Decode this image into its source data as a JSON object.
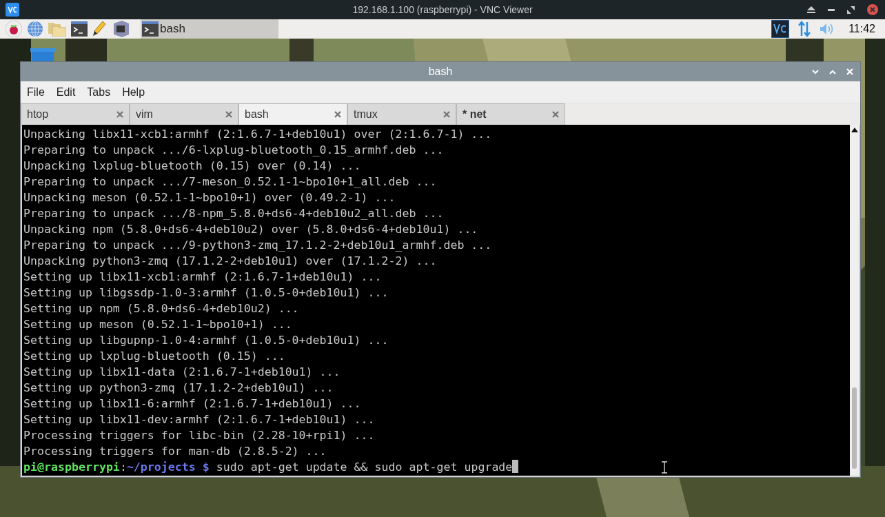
{
  "viewer": {
    "title": "192.168.1.100 (raspberrypi) - VNC Viewer"
  },
  "taskbar": {
    "task_buttons": [
      {
        "label": "bash",
        "selected": true
      }
    ],
    "clock": "11:42"
  },
  "terminal_window": {
    "title": "bash",
    "menu": [
      "File",
      "Edit",
      "Tabs",
      "Help"
    ],
    "tabs": [
      {
        "label": "htop",
        "selected": false,
        "bold": false
      },
      {
        "label": "vim",
        "selected": false,
        "bold": false
      },
      {
        "label": "bash",
        "selected": true,
        "bold": false
      },
      {
        "label": "tmux",
        "selected": false,
        "bold": false
      },
      {
        "label": "* net",
        "selected": false,
        "bold": true
      }
    ],
    "lines": [
      "Unpacking libx11-xcb1:armhf (2:1.6.7-1+deb10u1) over (2:1.6.7-1) ...",
      "Preparing to unpack .../6-lxplug-bluetooth_0.15_armhf.deb ...",
      "Unpacking lxplug-bluetooth (0.15) over (0.14) ...",
      "Preparing to unpack .../7-meson_0.52.1-1~bpo10+1_all.deb ...",
      "Unpacking meson (0.52.1-1~bpo10+1) over (0.49.2-1) ...",
      "Preparing to unpack .../8-npm_5.8.0+ds6-4+deb10u2_all.deb ...",
      "Unpacking npm (5.8.0+ds6-4+deb10u2) over (5.8.0+ds6-4+deb10u1) ...",
      "Preparing to unpack .../9-python3-zmq_17.1.2-2+deb10u1_armhf.deb ...",
      "Unpacking python3-zmq (17.1.2-2+deb10u1) over (17.1.2-2) ...",
      "Setting up libx11-xcb1:armhf (2:1.6.7-1+deb10u1) ...",
      "Setting up libgssdp-1.0-3:armhf (1.0.5-0+deb10u1) ...",
      "Setting up npm (5.8.0+ds6-4+deb10u2) ...",
      "Setting up meson (0.52.1-1~bpo10+1) ...",
      "Setting up libgupnp-1.0-4:armhf (1.0.5-0+deb10u1) ...",
      "Setting up lxplug-bluetooth (0.15) ...",
      "Setting up libx11-data (2:1.6.7-1+deb10u1) ...",
      "Setting up python3-zmq (17.1.2-2+deb10u1) ...",
      "Setting up libx11-6:armhf (2:1.6.7-1+deb10u1) ...",
      "Setting up libx11-dev:armhf (2:1.6.7-1+deb10u1) ...",
      "Processing triggers for libc-bin (2.28-10+rpi1) ...",
      "Processing triggers for man-db (2.8.5-2) ..."
    ],
    "prompt": {
      "user_host": "pi@raspberrypi",
      "separator": ":",
      "path": "~/projects $",
      "command": "sudo apt-get update && sudo apt-get upgrade"
    }
  }
}
